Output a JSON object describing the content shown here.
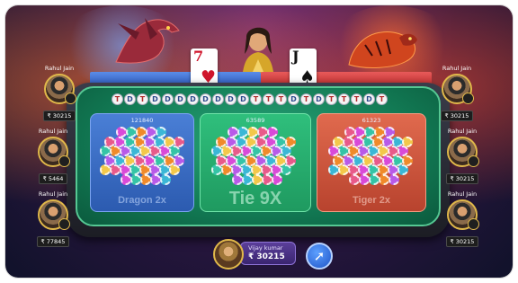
{
  "dealer_cards": {
    "left": {
      "rank": "7",
      "suit": "♥",
      "color": "#d0152b"
    },
    "right": {
      "rank": "J",
      "suit": "♠",
      "color": "#111111"
    }
  },
  "history": [
    "T",
    "D",
    "T",
    "D",
    "D",
    "D",
    "D",
    "D",
    "D",
    "D",
    "D",
    "T",
    "T",
    "T",
    "D",
    "T",
    "D",
    "T",
    "T",
    "T",
    "D",
    "T"
  ],
  "zones": {
    "dragon": {
      "count": "121840",
      "label": "Dragon 2x"
    },
    "tie": {
      "count": "63589",
      "label": "Tie 9X"
    },
    "tiger": {
      "count": "61323",
      "label": "Tiger 2x"
    }
  },
  "players_left": [
    {
      "name": "Rahul Jain",
      "balance": "₹ 30215"
    },
    {
      "name": "Rahul Jain",
      "balance": "₹ 5464"
    },
    {
      "name": "Rahul Jain",
      "balance": "₹ 77845"
    }
  ],
  "players_right": [
    {
      "name": "Rahul Jain",
      "balance": "₹ 30215"
    },
    {
      "name": "Rahul Jain",
      "balance": "₹ 30215"
    },
    {
      "name": "Rahul Jain",
      "balance": "₹ 30215"
    }
  ],
  "current_player": {
    "name": "Vijay kumar",
    "balance": "₹ 30215"
  },
  "share_icon": "share-arrow-icon",
  "colors": {
    "dragon": "#4a7fd6",
    "tie": "#2fbf7c",
    "tiger": "#e06a4e",
    "table": "#127a54"
  }
}
